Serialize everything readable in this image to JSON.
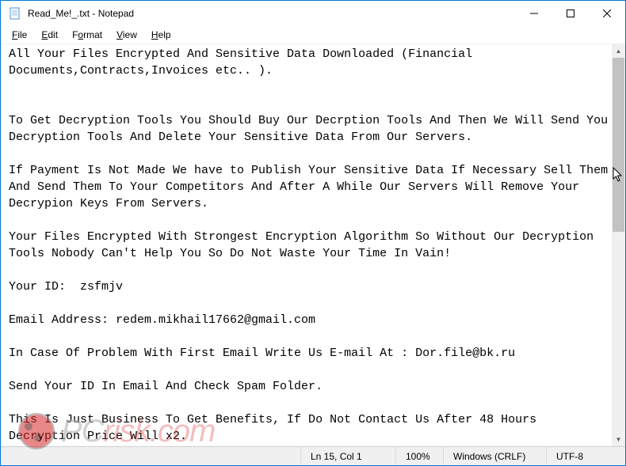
{
  "window": {
    "title": "Read_Me!_.txt - Notepad"
  },
  "menubar": {
    "file": "File",
    "edit": "Edit",
    "format": "Format",
    "view": "View",
    "help": "Help"
  },
  "document": {
    "body": "All Your Files Encrypted And Sensitive Data Downloaded (Financial Documents,Contracts,Invoices etc.. ).\n\n\nTo Get Decryption Tools You Should Buy Our Decrption Tools And Then We Will Send You Decryption Tools And Delete Your Sensitive Data From Our Servers.\n\nIf Payment Is Not Made We have to Publish Your Sensitive Data If Necessary Sell Them And Send Them To Your Competitors And After A While Our Servers Will Remove Your Decrypion Keys From Servers.\n\nYour Files Encrypted With Strongest Encryption Algorithm So Without Our Decryption Tools Nobody Can't Help You So Do Not Waste Your Time In Vain!\n\nYour ID:  zsfmjv\n\nEmail Address: redem.mikhail17662@gmail.com\n\nIn Case Of Problem With First Email Write Us E-mail At : Dor.file@bk.ru\n\nSend Your ID In Email And Check Spam Folder.\n\nThis Is Just Business To Get Benefits, If Do Not Contact Us After 48 Hours Decryption Price Will x2."
  },
  "statusbar": {
    "position": "Ln 15, Col 1",
    "zoom": "100%",
    "line_ending": "Windows (CRLF)",
    "encoding": "UTF-8"
  },
  "watermark": {
    "text_prefix": "PC",
    "text_suffix": "risk.com"
  }
}
